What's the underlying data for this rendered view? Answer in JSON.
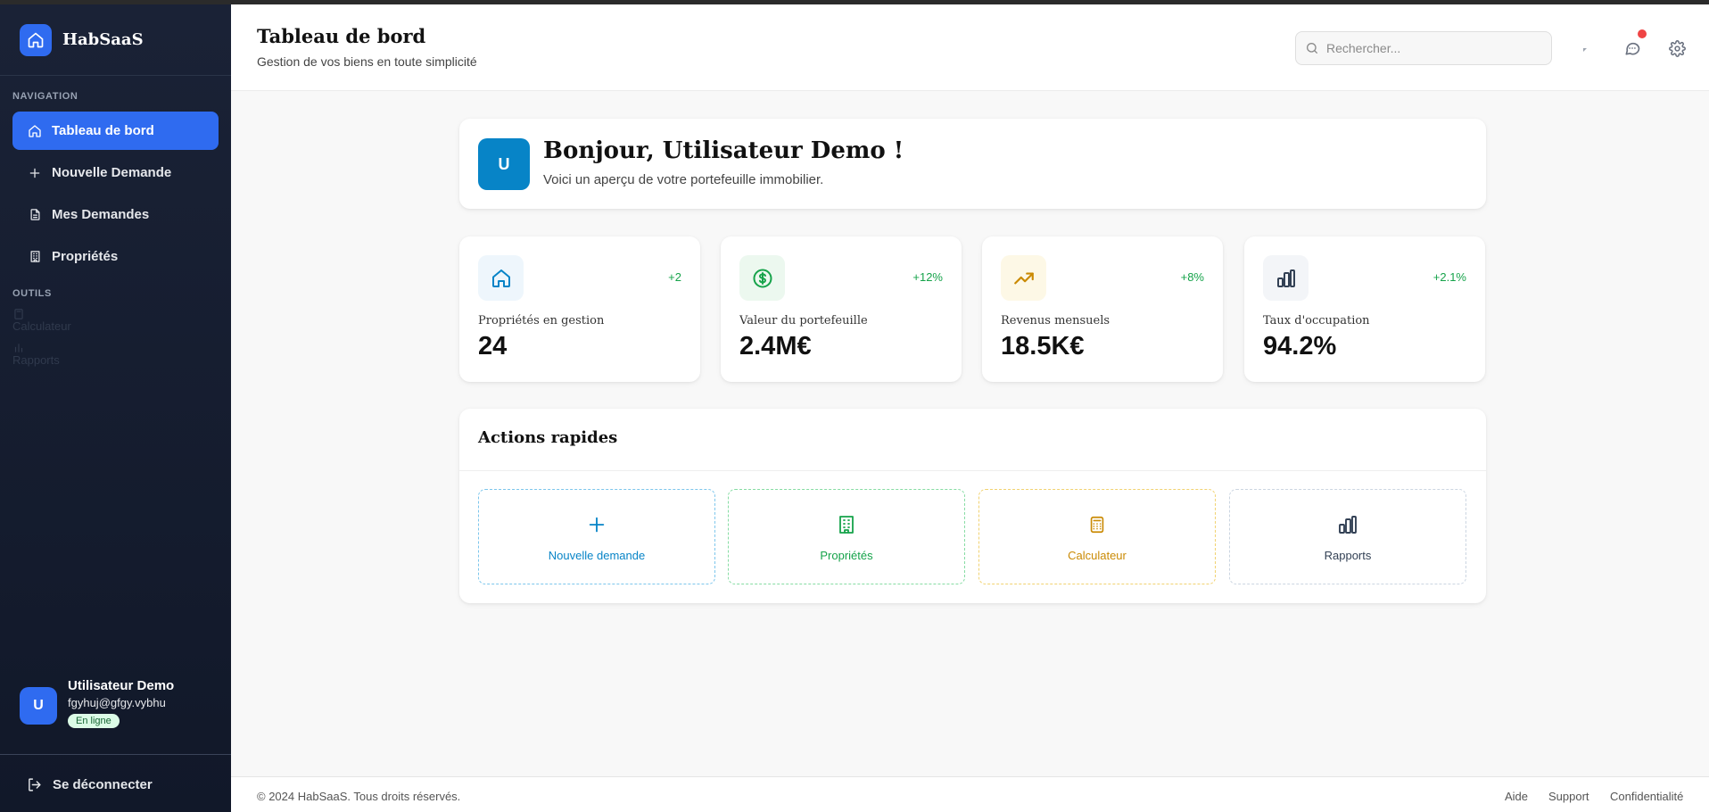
{
  "brand": {
    "name": "HabSaaS"
  },
  "sidebar": {
    "navigation_label": "NAVIGATION",
    "items": [
      {
        "label": "Tableau de bord",
        "icon": "home-icon",
        "active": true
      },
      {
        "label": "Nouvelle Demande",
        "icon": "plus-icon"
      },
      {
        "label": "Mes Demandes",
        "icon": "document-icon"
      },
      {
        "label": "Propriétés",
        "icon": "building-icon"
      }
    ],
    "tools_label": "OUTILS",
    "tools": [
      {
        "label": "Calculateur",
        "icon": "calculator-icon"
      },
      {
        "label": "Rapports",
        "icon": "chart-icon"
      }
    ],
    "user": {
      "initial": "U",
      "name": "Utilisateur Demo",
      "email": "fgyhuj@gfgy.vybhu",
      "status": "En ligne"
    },
    "logout_label": "Se déconnecter"
  },
  "header": {
    "title": "Tableau de bord",
    "subtitle": "Gestion de vos biens en toute simplicité",
    "search_placeholder": "Rechercher..."
  },
  "welcome": {
    "initial": "U",
    "title": "Bonjour, Utilisateur Demo !",
    "subtitle": "Voici un aperçu de votre portefeuille immobilier."
  },
  "stats": [
    {
      "label": "Propriétés en gestion",
      "value": "24",
      "delta": "+2",
      "icon": "home-icon",
      "icon_color": "#0784c7",
      "icon_bg": "#eef6fc"
    },
    {
      "label": "Valeur du portefeuille",
      "value": "2.4M€",
      "delta": "+12%",
      "icon": "dollar-icon",
      "icon_color": "#16a34a",
      "icon_bg": "#ecf8ef"
    },
    {
      "label": "Revenus mensuels",
      "value": "18.5K€",
      "delta": "+8%",
      "icon": "trending-up-icon",
      "icon_color": "#ca8a04",
      "icon_bg": "#fdf8e6"
    },
    {
      "label": "Taux d'occupation",
      "value": "94.2%",
      "delta": "+2.1%",
      "icon": "bar-chart-icon",
      "icon_color": "#334155",
      "icon_bg": "#f3f5f8"
    }
  ],
  "quick_actions": {
    "title": "Actions rapides",
    "items": [
      {
        "label": "Nouvelle demande",
        "icon": "plus-icon",
        "color": "#0784c7"
      },
      {
        "label": "Propriétés",
        "icon": "building-icon",
        "color": "#16a34a"
      },
      {
        "label": "Calculateur",
        "icon": "calculator-icon",
        "color": "#ca8a04"
      },
      {
        "label": "Rapports",
        "icon": "bar-chart-icon",
        "color": "#334155"
      }
    ]
  },
  "footer": {
    "copyright": "© 2024 HabSaaS. Tous droits réservés.",
    "links": [
      "Aide",
      "Support",
      "Confidentialité"
    ]
  },
  "colors": {
    "accent": "#2f6bf0",
    "sidebar_bg": "#1a2236",
    "notification": "#ef4444",
    "positive": "#16a34a"
  }
}
